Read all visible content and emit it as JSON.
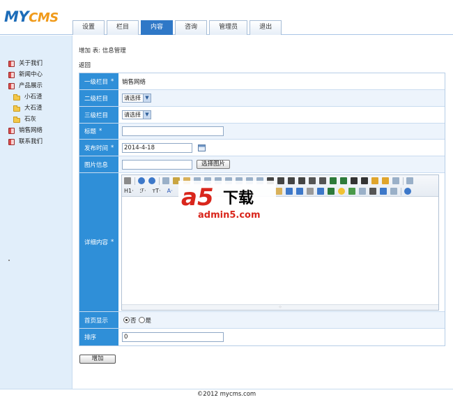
{
  "logo": {
    "part1": "MY",
    "part2": "CMS"
  },
  "tabs": [
    {
      "label": "设置"
    },
    {
      "label": "栏目"
    },
    {
      "label": "内容"
    },
    {
      "label": "咨询"
    },
    {
      "label": "管理员"
    },
    {
      "label": "退出"
    }
  ],
  "active_tab_index": 2,
  "sidebar": {
    "items": [
      {
        "label": "关于我们"
      },
      {
        "label": "新闻中心"
      },
      {
        "label": "产品展示"
      },
      {
        "label": "小石渣"
      },
      {
        "label": "大石渣"
      },
      {
        "label": "石灰"
      },
      {
        "label": "销售网络"
      },
      {
        "label": "联系我们"
      }
    ]
  },
  "main": {
    "breadcrumb": "增加 表: 信息管理",
    "back": "返回"
  },
  "form": {
    "level1": {
      "label": "一级栏目",
      "required": "*",
      "value": "销售网络"
    },
    "level2": {
      "label": "二级栏目",
      "select": "请选择"
    },
    "level3": {
      "label": "三级栏目",
      "select": "请选择"
    },
    "title": {
      "label": "标题",
      "required": "*",
      "value": ""
    },
    "date": {
      "label": "发布时间",
      "required": "*",
      "value": "2014-4-18"
    },
    "image": {
      "label": "图片信息",
      "value": "",
      "button": "选择图片"
    },
    "content": {
      "label": "详细内容",
      "required": "*"
    },
    "home": {
      "label": "首页显示",
      "no": "否",
      "yes": "是",
      "selected": "否"
    },
    "order": {
      "label": "排序",
      "value": "0"
    }
  },
  "editor": {
    "heading_btn": "H1·",
    "font_btn": "ℱ·",
    "size_btn": "тT·",
    "color_btn": "A·"
  },
  "watermark": {
    "brand": "a5",
    "text": "下载",
    "url": "admin5.com"
  },
  "submit": {
    "label": "增加"
  },
  "footer": {
    "text": "©2012 mycms.com"
  }
}
